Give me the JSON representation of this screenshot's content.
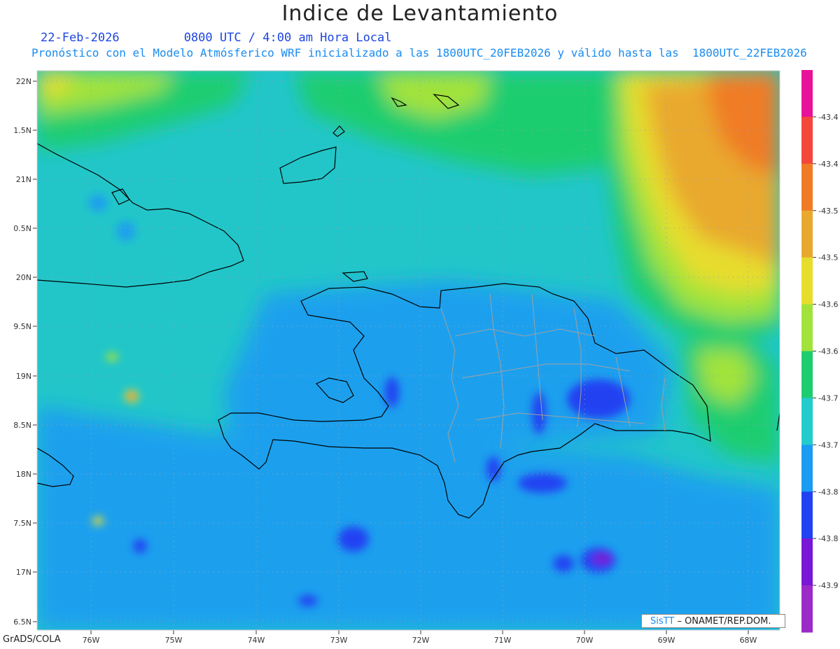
{
  "header": {
    "title": "Indice de Levantamiento",
    "date_line": "22-Feb-2026         0800 UTC / 4:00 am Hora Local",
    "model_line": "Pronóstico con el Modelo Atmósferico WRF inicializado a las 1800UTC_20FEB2026 y válido hasta las  1800UTC_22FEB2026"
  },
  "axes": {
    "lat_labels": [
      "22N",
      "1.5N",
      "21N",
      "0.5N",
      "20N",
      "9.5N",
      "19N",
      "8.5N",
      "18N",
      "7.5N",
      "17N",
      "6.5N"
    ],
    "lon_labels": [
      "76W",
      "75W",
      "74W",
      "73W",
      "72W",
      "71W",
      "70W",
      "69W",
      "68W"
    ]
  },
  "colorbar": {
    "labels": [
      "-43.4",
      "-43.4",
      "-43.5",
      "-43.5",
      "-43.6",
      "-43.6",
      "-43.7",
      "-43.7",
      "-43.8",
      "-43.8",
      "-43.9"
    ],
    "colors": [
      "#e8129a",
      "#f4463a",
      "#f07b25",
      "#e9a92f",
      "#e7dd2d",
      "#a2e33b",
      "#1ecd6f",
      "#22cccd",
      "#1a9cf3",
      "#2042f2",
      "#7a16d6",
      "#9c2ac8"
    ]
  },
  "credit": {
    "brand": "SisTT",
    "text": "– ONAMET/REP.DOM."
  },
  "footer": {
    "software": "GrADS/COLA"
  },
  "palette": {
    "ocean_base": "#22c6c9",
    "south_sea": "#1aa0ee",
    "northeast_high": "#e9a92f",
    "coast_line": "#000000",
    "province_line": "#a0a0a0"
  }
}
